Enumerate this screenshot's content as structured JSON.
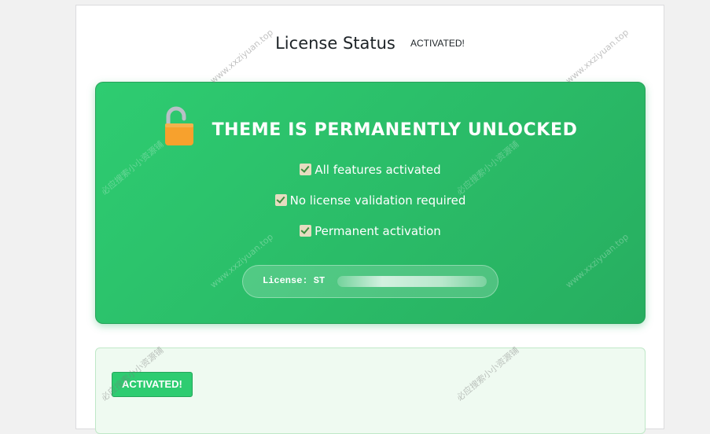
{
  "header": {
    "title": "License Status",
    "status_badge": "ACTIVATED!"
  },
  "unlock_card": {
    "title": "THEME IS PERMANENTLY UNLOCKED",
    "lock_icon": "open-padlock-icon",
    "features": [
      "All features activated",
      "No license validation required",
      "Permanent activation"
    ],
    "license_label": "License: ST"
  },
  "activation_panel": {
    "button_label": "ACTIVATED!"
  },
  "watermarks": {
    "site": "www.xxziyuan.top",
    "cn": "必应搜索小小资源铺"
  },
  "colors": {
    "card_green": "#2ecc71",
    "card_green_dark": "#27ae60",
    "lock_orange": "#f7a12d",
    "panel_bg": "#effaf1"
  }
}
